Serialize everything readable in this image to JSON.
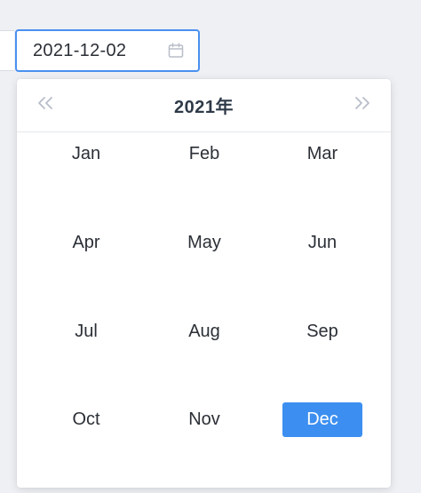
{
  "date_input": {
    "value": "2021-12-02",
    "icon": "calendar-icon"
  },
  "picker": {
    "header": {
      "year_label": "2021年",
      "prev_icon": "double-chevron-left-icon",
      "next_icon": "double-chevron-right-icon"
    },
    "months": [
      {
        "label": "Jan",
        "selected": false
      },
      {
        "label": "Feb",
        "selected": false
      },
      {
        "label": "Mar",
        "selected": false
      },
      {
        "label": "Apr",
        "selected": false
      },
      {
        "label": "May",
        "selected": false
      },
      {
        "label": "Jun",
        "selected": false
      },
      {
        "label": "Jul",
        "selected": false
      },
      {
        "label": "Aug",
        "selected": false
      },
      {
        "label": "Sep",
        "selected": false
      },
      {
        "label": "Oct",
        "selected": false
      },
      {
        "label": "Nov",
        "selected": false
      },
      {
        "label": "Dec",
        "selected": true
      }
    ]
  },
  "colors": {
    "accent": "#3c8ff0",
    "input_border_focus": "#4a90f0",
    "text": "#2b2f36",
    "muted_icon": "#b8bec8"
  }
}
